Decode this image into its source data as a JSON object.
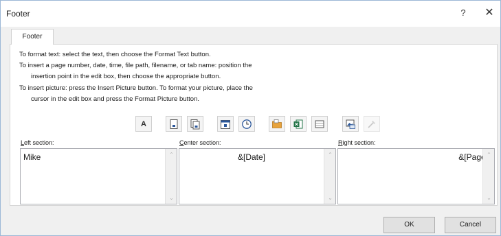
{
  "window": {
    "title": "Footer",
    "help_label": "?",
    "close_label": "✕"
  },
  "tabs": [
    {
      "label": "Footer"
    }
  ],
  "instructions": [
    "To format text:  select the text, then choose the Format Text button.",
    "To insert a page number, date, time, file path, filename, or tab name:  position the",
    "insertion point in the edit box, then choose the appropriate button.",
    "To insert picture: press the Insert Picture button.  To format your picture, place the",
    "cursor in the edit box and press the Format Picture button."
  ],
  "toolbar": {
    "format_text_label": "A",
    "icons": [
      "format-text-icon",
      "insert-page-number-icon",
      "insert-number-of-pages-icon",
      "insert-date-icon",
      "insert-time-icon",
      "insert-file-path-icon",
      "insert-file-name-icon",
      "insert-sheet-name-icon",
      "insert-picture-icon",
      "format-picture-icon"
    ],
    "accent_color": "#2b579a",
    "excel_green": "#217346",
    "folder_orange": "#e8a33c"
  },
  "sections": {
    "left": {
      "accel": "L",
      "label_rest": "eft section:",
      "value": "Mike"
    },
    "center": {
      "accel": "C",
      "label_rest": "enter section:",
      "value": "&[Date]"
    },
    "right": {
      "accel": "R",
      "label_rest": "ight section:",
      "value": "&[Page]"
    }
  },
  "buttons": {
    "ok": "OK",
    "cancel": "Cancel"
  }
}
